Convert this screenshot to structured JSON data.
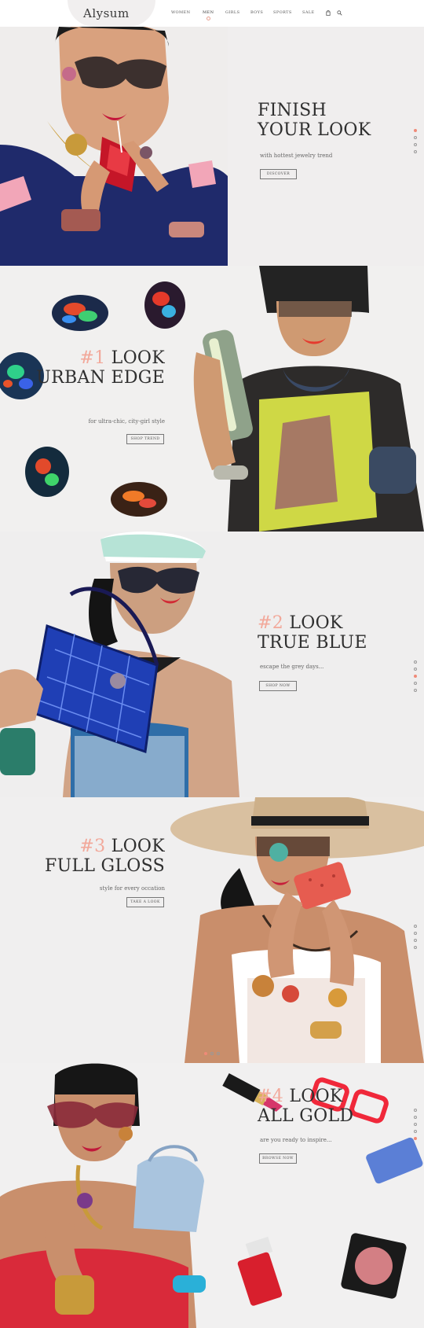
{
  "header": {
    "logo": "Alysum",
    "nav": [
      "WOMEN",
      "MEN",
      "GIRLS",
      "BOYS",
      "SPORTS",
      "SALE"
    ],
    "active_nav": "MEN",
    "cart_icon": "bag-icon",
    "search_icon": "search-icon"
  },
  "sections": [
    {
      "headline_line1": "FINISH",
      "headline_line2": "YOUR LOOK",
      "subline": "with hottest jewelry trend",
      "button": "DISCOVER",
      "active_dot": 1
    },
    {
      "number": "#1",
      "headline_line1": "LOOK",
      "headline_line2": "URBAN EDGE",
      "subline": "for ultra-chic, city-girl style",
      "button": "SHOP TREND"
    },
    {
      "number": "#2",
      "headline_line1": "LOOK",
      "headline_line2": "TRUE BLUE",
      "subline": "escape the grey days...",
      "button": "SHOP NOW",
      "active_dot": 3
    },
    {
      "number": "#3",
      "headline_line1": "LOOK",
      "headline_line2": "FULL GLOSS",
      "subline": "style for every occation",
      "button": "TAKE A LOOK",
      "active_dot": 1
    },
    {
      "number": "#4",
      "headline_line1": "LOOK",
      "headline_line2": "ALL GOLD",
      "subline": "are you ready to inspire...",
      "button": "BROWSE NOW",
      "active_dot": 5
    }
  ],
  "colors": {
    "accent": "#f2a89a",
    "dot_active": "#f08a78",
    "text_dark": "#2f2f2f",
    "background": "#f0eeee"
  }
}
